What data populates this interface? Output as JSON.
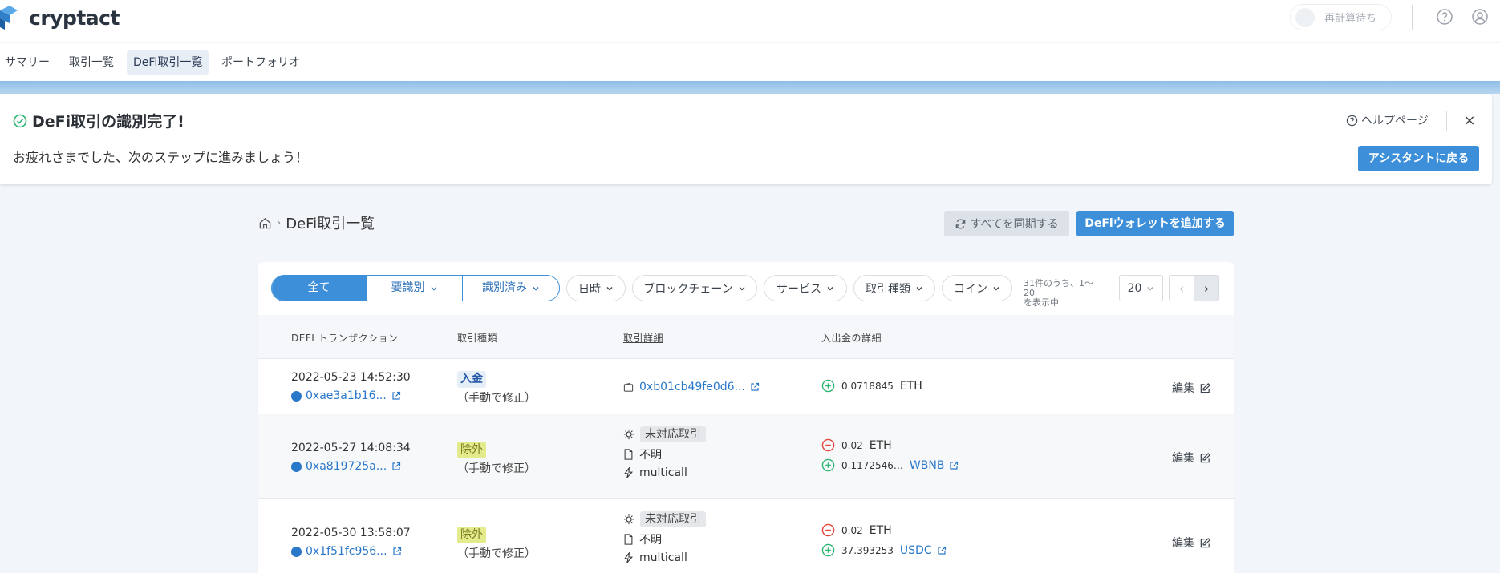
{
  "app": {
    "name": "cryptact"
  },
  "header": {
    "recalc_label": "再計算待ち",
    "help_icon": "question-circle-icon",
    "account_icon": "user-circle-icon"
  },
  "nav": {
    "items": [
      "サマリー",
      "取引一覧",
      "DeFi取引一覧",
      "ポートフォリオ"
    ],
    "active": "DeFi取引一覧"
  },
  "banner": {
    "title": "DeFi取引の識別完了!",
    "message": "お疲れさまでした、次のステップに進みましょう！",
    "help_label": "ヘルプページ",
    "close_label": "×",
    "assistant_button": "アシスタントに戻る"
  },
  "page": {
    "breadcrumb_current": "DeFi取引一覧",
    "sync_button": "すべてを同期する",
    "add_wallet_button": "DeFiウォレットを追加する"
  },
  "filters": {
    "segments": [
      "全て",
      "要識別",
      "識別済み"
    ],
    "dropdowns": [
      "日時",
      "ブロックチェーン",
      "サービス",
      "取引種類",
      "コイン"
    ],
    "count_line1": "31件のうち、1〜20",
    "count_line2": "を表示中",
    "per_page": "20",
    "prev": "‹",
    "next": "›"
  },
  "table": {
    "headers": [
      "DEFI トランザクション",
      "取引種類",
      "取引詳細",
      "入出金の詳細"
    ],
    "edit_label": "編集",
    "rows": [
      {
        "date": "2022-05-23 14:52:30",
        "hash": "0xae3a1b16...",
        "type": "入金",
        "note": "（手動で修正）",
        "detail_link": "0xb01cb49fe0d6...",
        "flows": [
          {
            "dir": "in",
            "amount": "0.0718845",
            "currency": "ETH"
          }
        ]
      },
      {
        "date": "2022-05-27 14:08:34",
        "hash": "0xa819725a...",
        "type": "除外",
        "note": "（手動で修正）",
        "detail_tag": "未対応取引",
        "detail_contract": "不明",
        "detail_method": "multicall",
        "flows": [
          {
            "dir": "out",
            "amount": "0.02",
            "currency": "ETH"
          },
          {
            "dir": "in",
            "amount": "0.1172546…",
            "currency": "WBNB"
          }
        ]
      },
      {
        "date": "2022-05-30 13:58:07",
        "hash": "0x1f51fc956...",
        "type": "除外",
        "note": "（手動で修正）",
        "detail_tag": "未対応取引",
        "detail_contract": "不明",
        "detail_method": "multicall",
        "flows": [
          {
            "dir": "out",
            "amount": "0.02",
            "currency": "ETH"
          },
          {
            "dir": "in",
            "amount": "37.393253",
            "currency": "USDC"
          }
        ]
      }
    ]
  },
  "colors": {
    "accent": "#3d8fd9",
    "in": "#2bb673",
    "out": "#e0443a",
    "exclude_badge": "#e3eb8d"
  }
}
